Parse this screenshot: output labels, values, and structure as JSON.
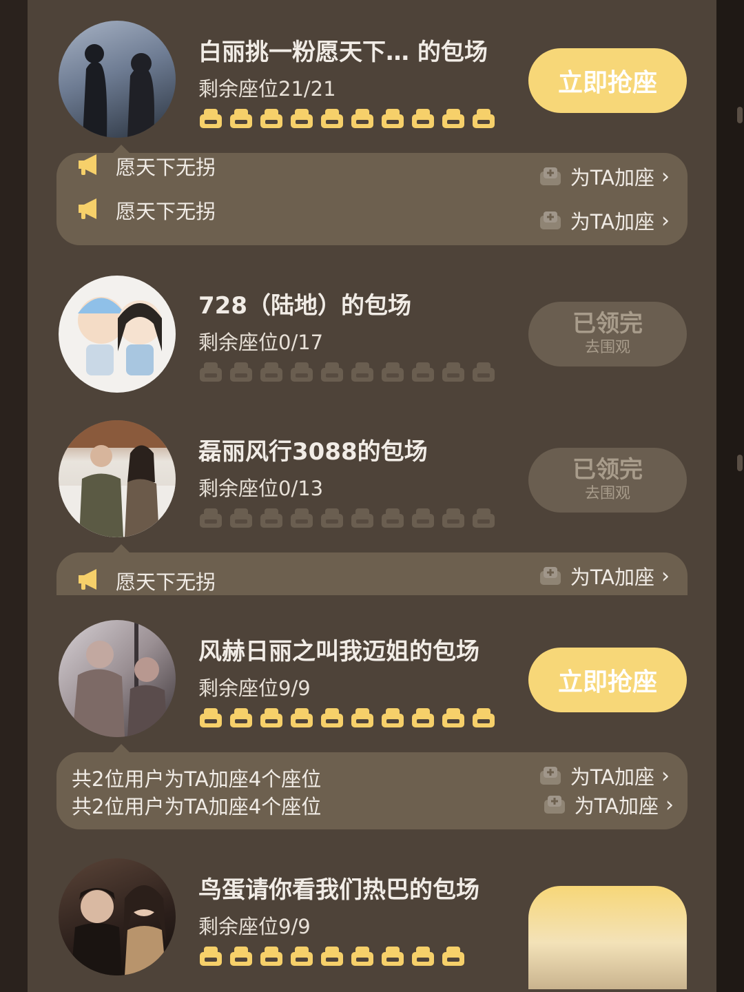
{
  "rooms": [
    {
      "title": "白丽挑一粉愿天下… 的包场",
      "seats_text": "剩余座位21/21",
      "button": {
        "label": "立即抢座",
        "sub": ""
      }
    },
    {
      "title": "728（陆地）的包场",
      "seats_text": "剩余座位0/17",
      "button": {
        "label": "已领完",
        "sub": "去围观"
      }
    },
    {
      "title": "磊丽风行3088的包场",
      "seats_text": "剩余座位0/13",
      "button": {
        "label": "已领完",
        "sub": "去围观"
      }
    },
    {
      "title": "风赫日丽之叫我迈姐的包场",
      "seats_text": "剩余座位9/9",
      "button": {
        "label": "立即抢座",
        "sub": ""
      }
    },
    {
      "title": "鸟蛋请你看我们热巴的包场",
      "seats_text": "剩余座位9/9",
      "button": {
        "label": "",
        "sub": ""
      }
    }
  ],
  "bubbles": {
    "b1": {
      "line1": "愿天下无拐",
      "line2": "愿天下无拐",
      "add1": "为TA加座",
      "add2": "为TA加座"
    },
    "b2": {
      "line1": "愿天下无拐",
      "add1": "为TA加座"
    },
    "b3": {
      "line1": "共2位用户为TA加座4个座位",
      "line2": "共2位用户为TA加座4个座位",
      "add1": "为TA加座",
      "add2": "为TA加座"
    }
  },
  "icons": {
    "seat": "seat-icon",
    "horn": "megaphone-icon",
    "add_seat": "add-seat-icon",
    "chevron": "chevron-right-icon"
  },
  "colors": {
    "gold": "#f7d778",
    "seat_on": "#f6d06a",
    "seat_off": "#6a5e50",
    "panel": "#4e4339",
    "bubble": "#6d604f"
  }
}
